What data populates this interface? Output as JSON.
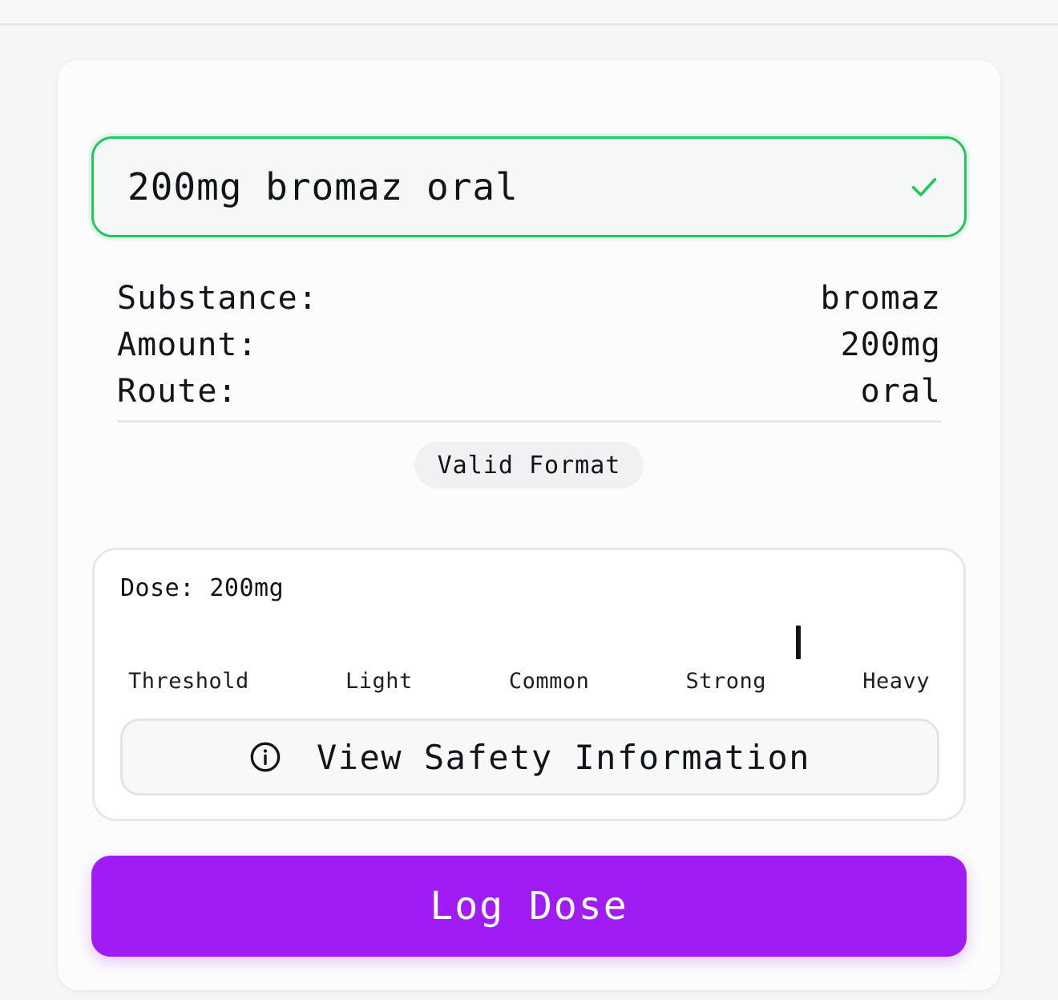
{
  "dose_input": {
    "value": "200mg bromaz oral",
    "status_icon": "check-icon"
  },
  "parsed": {
    "substance_label": "Substance:",
    "substance_value": "bromaz",
    "amount_label": "Amount:",
    "amount_value": "200mg",
    "route_label": "Route:",
    "route_value": "oral"
  },
  "badge": {
    "label": "Valid Format"
  },
  "dose_panel": {
    "dose_prefix": "Dose:",
    "dose_value": "200mg",
    "scale_labels": [
      "Threshold",
      "Light",
      "Common",
      "Strong",
      "Heavy"
    ],
    "safety_button_label": "View Safety Information",
    "safety_icon": "info-icon"
  },
  "log_button": {
    "label": "Log Dose"
  },
  "colors": {
    "valid_border": "#22c55e",
    "primary_button": "#a01cf5",
    "background": "#f5f6f6"
  }
}
